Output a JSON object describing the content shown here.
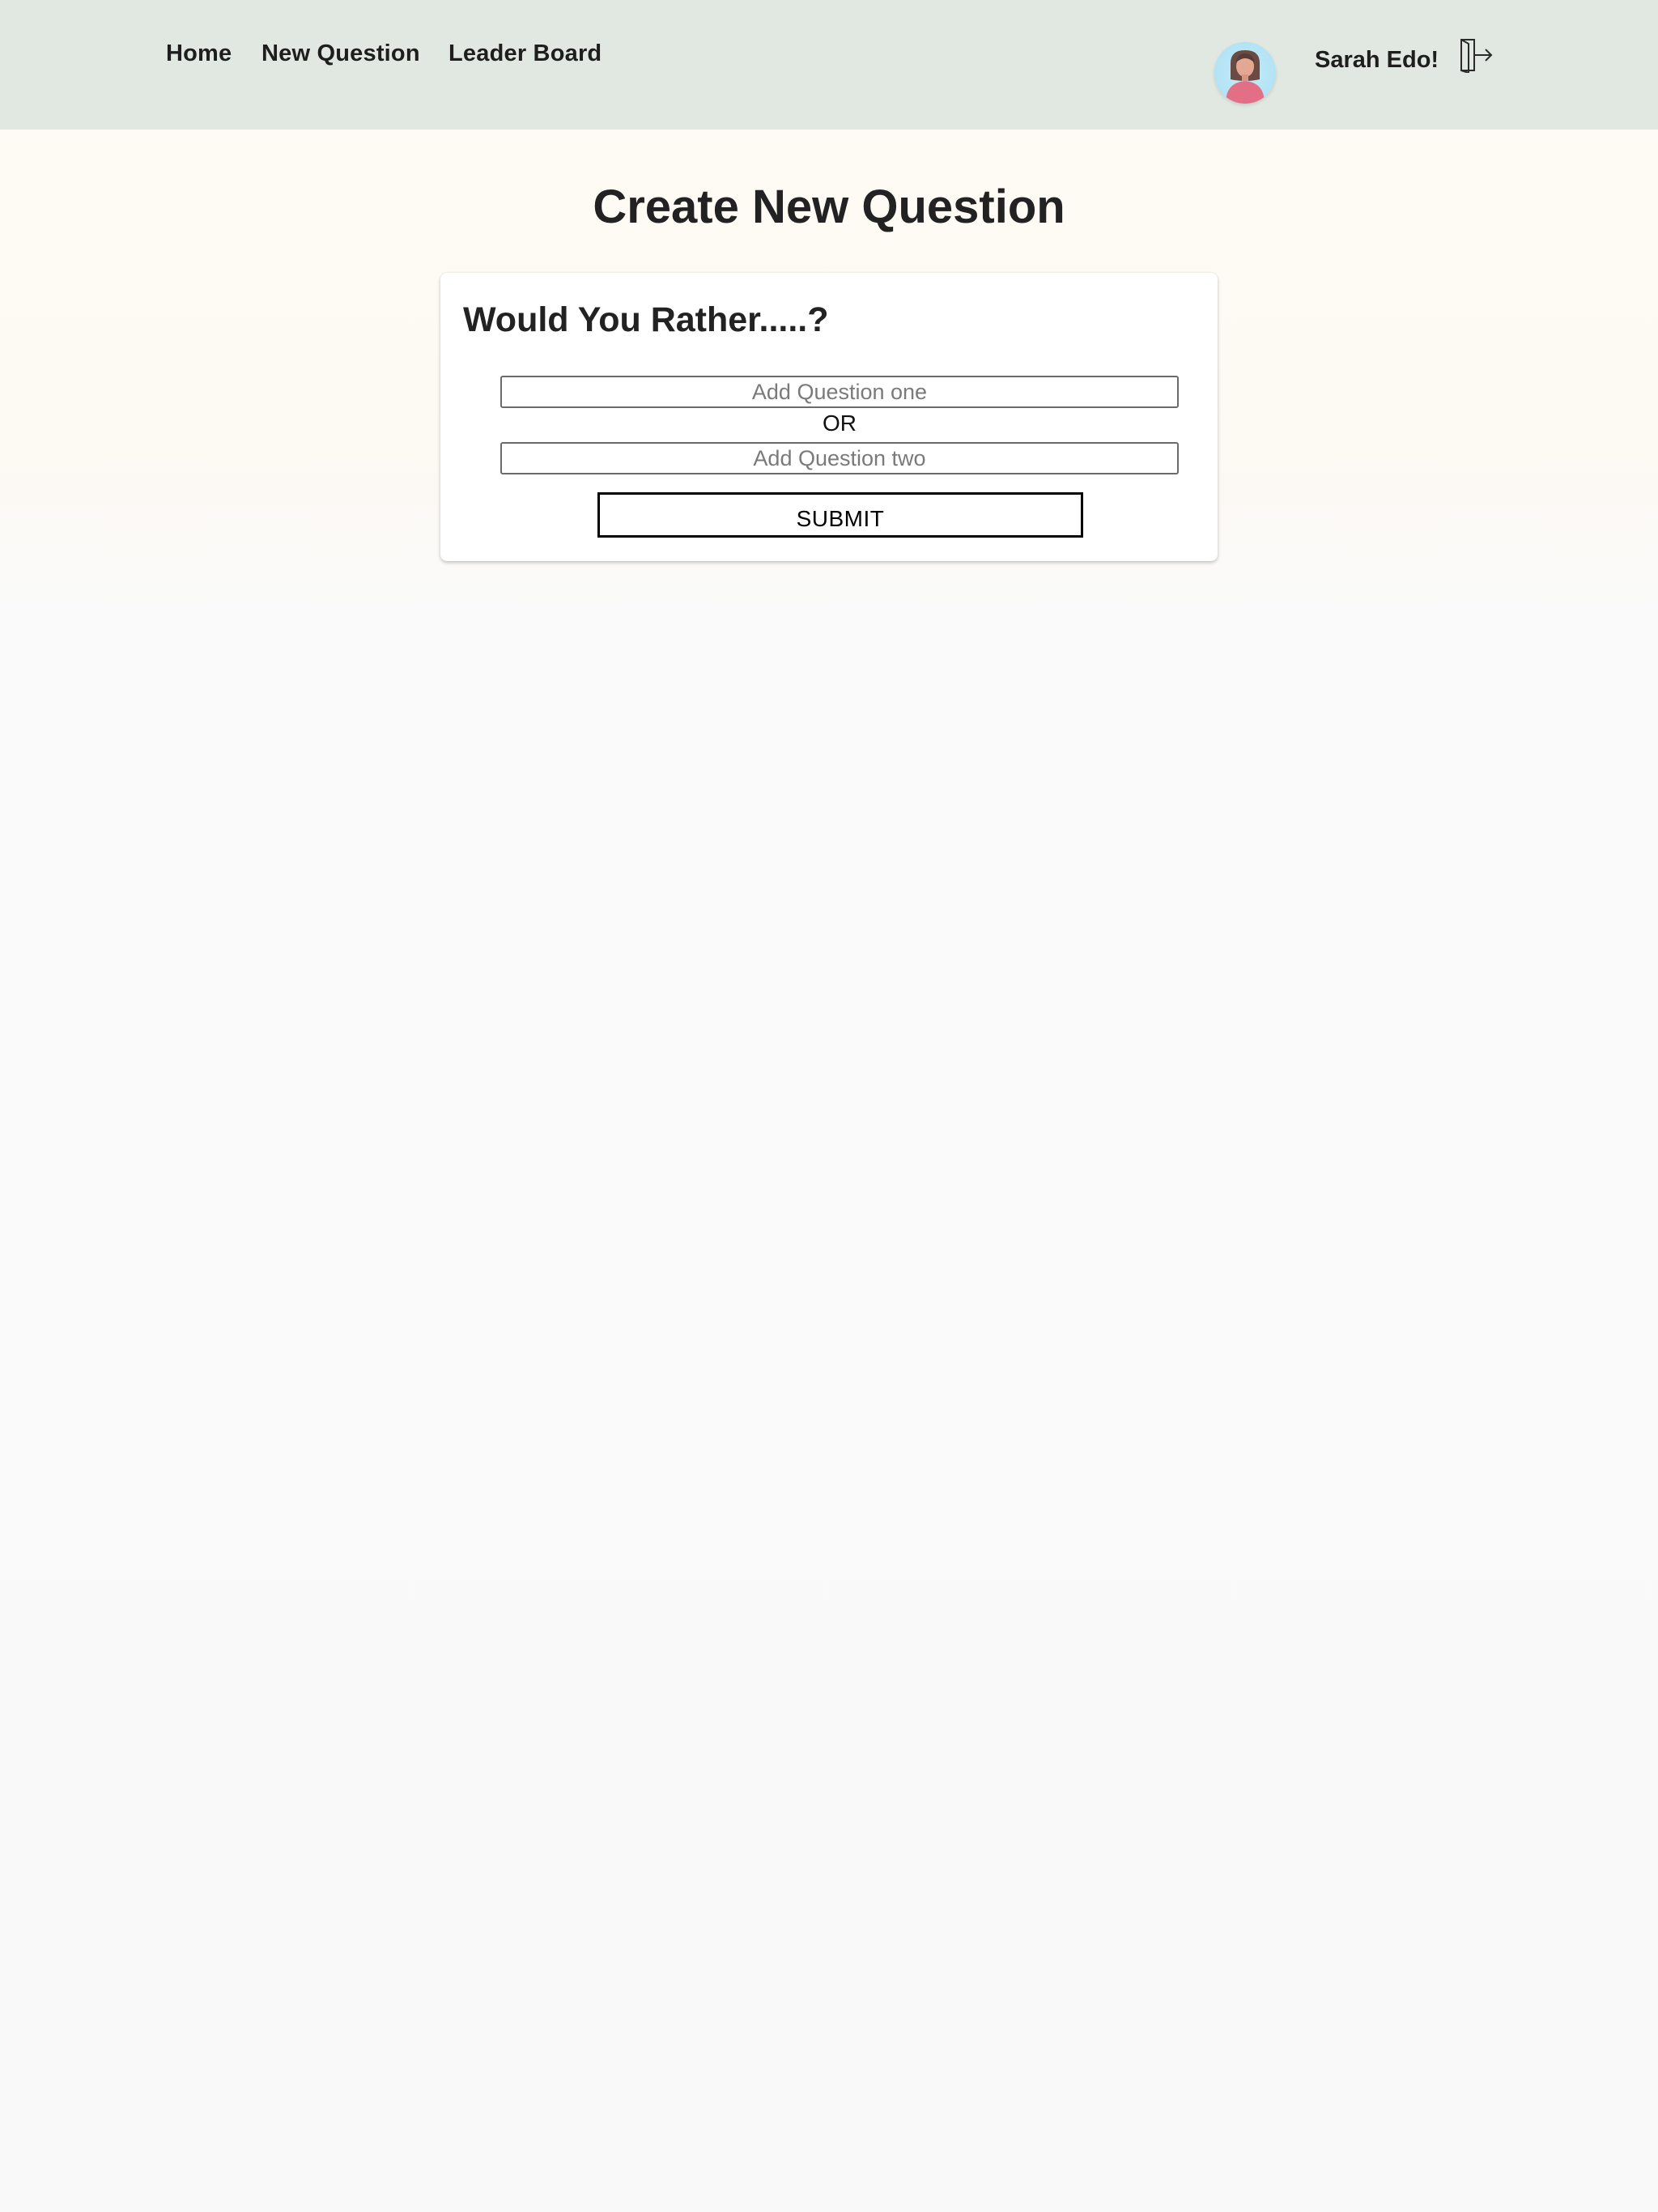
{
  "navbar": {
    "links": [
      {
        "label": "Home"
      },
      {
        "label": "New Question"
      },
      {
        "label": "Leader Board"
      }
    ],
    "user": {
      "name": "Sarah Edo!",
      "avatar_icon": "female-avatar-icon",
      "logout_icon": "logout-door-icon"
    },
    "background_color": "#e0e8e1"
  },
  "main": {
    "title": "Create New Question",
    "card": {
      "heading": "Would You Rather.....?",
      "option_one": {
        "value": "",
        "placeholder": "Add Question one"
      },
      "separator": "OR",
      "option_two": {
        "value": "",
        "placeholder": "Add Question two"
      },
      "submit_label": "SUBMIT"
    }
  }
}
